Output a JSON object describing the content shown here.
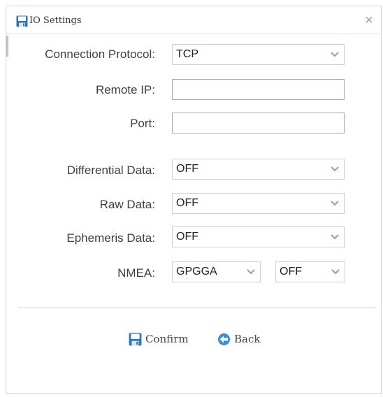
{
  "dialog": {
    "title": "IO Settings",
    "close_symbol": "×",
    "icons": {
      "title": "save-disk-icon",
      "close": "close-icon",
      "dropdown": "chevron-down-icon",
      "confirm": "save-disk-icon",
      "back": "back-arrow-icon"
    },
    "colors": {
      "accent": "#2e74c4",
      "arrow": "#7fa9d6",
      "border": "#cfcfcf"
    }
  },
  "form": {
    "connection_protocol": {
      "label": "Connection Protocol:",
      "value": "TCP"
    },
    "remote_ip": {
      "label": "Remote IP:",
      "value": ""
    },
    "port": {
      "label": "Port:",
      "value": ""
    },
    "differential_data": {
      "label": "Differential Data:",
      "value": "OFF"
    },
    "raw_data": {
      "label": "Raw Data:",
      "value": "OFF"
    },
    "ephemeris_data": {
      "label": "Ephemeris Data:",
      "value": "OFF"
    },
    "nmea": {
      "label": "NMEA:",
      "sentence": "GPGGA",
      "rate": "OFF"
    }
  },
  "actions": {
    "confirm_label": "Confirm",
    "back_label": "Back"
  }
}
